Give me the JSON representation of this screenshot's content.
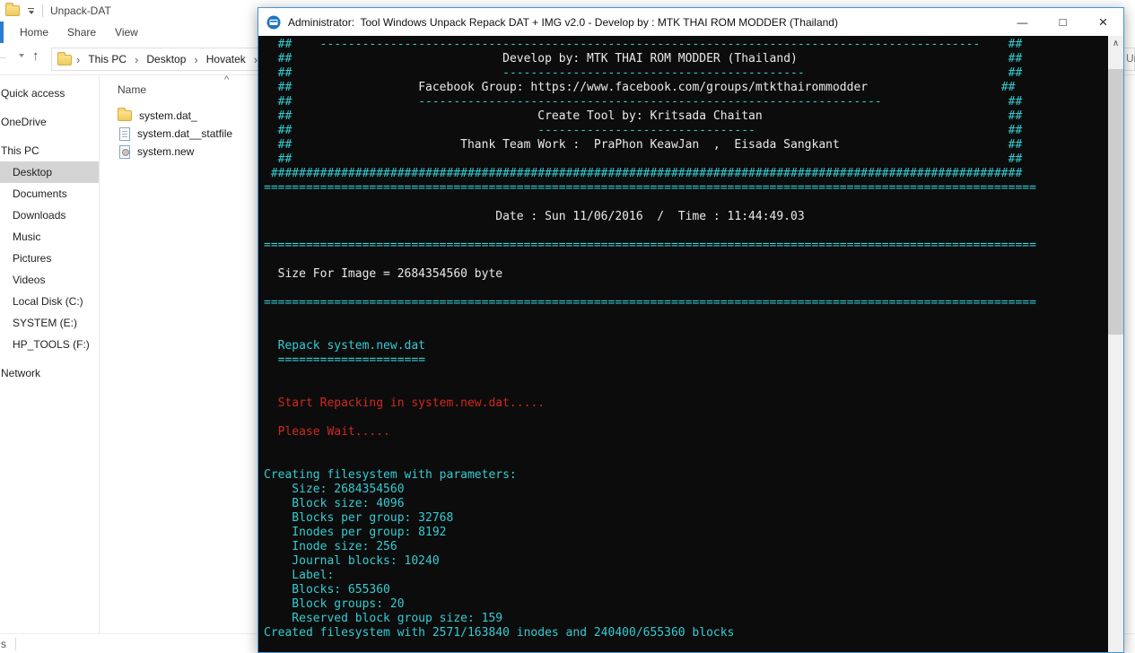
{
  "explorer": {
    "window_title": "Unpack-DAT",
    "ribbon_tabs": [
      "Home",
      "Share",
      "View"
    ],
    "breadcrumb": [
      "This PC",
      "Desktop",
      "Hovatek"
    ],
    "search_fragment": "Un",
    "status_fragment": "s",
    "icons": {
      "chevron": "›",
      "back": "←",
      "up": "↑",
      "sort": "^"
    },
    "sidebar": [
      {
        "label": "Quick access",
        "level": 0
      },
      {
        "label": "OneDrive",
        "level": 0
      },
      {
        "label": "This PC",
        "level": 0
      },
      {
        "label": "Desktop",
        "level": 1,
        "selected": true
      },
      {
        "label": "Documents",
        "level": 1
      },
      {
        "label": "Downloads",
        "level": 1
      },
      {
        "label": "Music",
        "level": 1
      },
      {
        "label": "Pictures",
        "level": 1
      },
      {
        "label": "Videos",
        "level": 1
      },
      {
        "label": "Local Disk (C:)",
        "level": 1
      },
      {
        "label": "SYSTEM (E:)",
        "level": 1
      },
      {
        "label": "HP_TOOLS (F:)",
        "level": 1
      },
      {
        "label": "Network",
        "level": 0
      }
    ],
    "file_list": {
      "column_header": "Name",
      "files": [
        {
          "name": "system.dat_",
          "icon": "folder"
        },
        {
          "name": "system.dat__statfile",
          "icon": "text-file"
        },
        {
          "name": "system.new",
          "icon": "generic-file"
        }
      ]
    }
  },
  "console": {
    "title": "Administrator:  Tool Windows Unpack Repack DAT + IMG v2.0 - Develop by : MTK THAI ROM MODDER (Thailand)",
    "icons": {
      "minimize": "—",
      "maximize": "□",
      "close": "×",
      "scroll_up": "∧"
    },
    "colors": {
      "cyan": "#35ccd2",
      "white": "#e9e9e9",
      "red": "#d0281f",
      "background": "#0c0c0c"
    },
    "lines": [
      [
        [
          "c",
          "  ##    "
        ],
        [
          "c",
          "-",
          94
        ],
        [
          "c",
          " ",
          4
        ],
        [
          "c",
          "##"
        ]
      ],
      [
        [
          "c",
          "  ##"
        ],
        [
          "c",
          " ",
          30
        ],
        [
          "w",
          "Develop by: MTK THAI ROM MODDER (Thailand)"
        ],
        [
          "c",
          " ",
          30
        ],
        [
          "c",
          "##"
        ]
      ],
      [
        [
          "c",
          "  ##"
        ],
        [
          "c",
          " ",
          30
        ],
        [
          "c",
          "-",
          43
        ],
        [
          "c",
          " ",
          29
        ],
        [
          "c",
          "##"
        ]
      ],
      [
        [
          "c",
          "  ##"
        ],
        [
          "c",
          " ",
          18
        ],
        [
          "w",
          "Facebook Group: https://www.facebook.com/groups/mtkthairommodder"
        ],
        [
          "c",
          " ",
          19
        ],
        [
          "c",
          "##"
        ]
      ],
      [
        [
          "c",
          "  ##"
        ],
        [
          "c",
          " ",
          18
        ],
        [
          "c",
          "-",
          66
        ],
        [
          "c",
          " ",
          18
        ],
        [
          "c",
          "##"
        ]
      ],
      [
        [
          "c",
          "  ##"
        ],
        [
          "c",
          " ",
          35
        ],
        [
          "w",
          "Create Tool by: Kritsada Chaitan"
        ],
        [
          "c",
          " ",
          35
        ],
        [
          "c",
          "##"
        ]
      ],
      [
        [
          "c",
          "  ##"
        ],
        [
          "c",
          " ",
          35
        ],
        [
          "c",
          "-",
          31
        ],
        [
          "c",
          " ",
          36
        ],
        [
          "c",
          "##"
        ]
      ],
      [
        [
          "c",
          "  ##"
        ],
        [
          "c",
          " ",
          24
        ],
        [
          "w",
          "Thank Team Work :  PraPhon KeawJan  ,  Eisada Sangkant"
        ],
        [
          "c",
          " ",
          24
        ],
        [
          "c",
          "##"
        ]
      ],
      [
        [
          "c",
          "  ##"
        ],
        [
          "c",
          " ",
          102
        ],
        [
          "c",
          "##"
        ]
      ],
      [
        [
          "c",
          " "
        ],
        [
          "c",
          "#",
          107
        ]
      ],
      [
        [
          "c",
          "=",
          110
        ]
      ],
      [],
      [
        [
          "c",
          " ",
          33
        ],
        [
          "w",
          "Date : Sun 11/06/2016  /  Time : 11:44:49.03"
        ]
      ],
      [],
      [
        [
          "c",
          "=",
          110
        ]
      ],
      [],
      [
        [
          "w",
          "  Size For Image = 2684354560 byte"
        ]
      ],
      [],
      [
        [
          "c",
          "=",
          110
        ]
      ],
      [],
      [],
      [
        [
          "c",
          "  Repack system.new.dat"
        ]
      ],
      [
        [
          "c",
          "  "
        ],
        [
          "c",
          "=",
          21
        ]
      ],
      [],
      [],
      [
        [
          "r",
          "  Start Repacking in system.new.dat....."
        ]
      ],
      [],
      [
        [
          "r",
          "  Please Wait....."
        ]
      ],
      [],
      [],
      [
        [
          "c",
          "Creating filesystem with parameters:"
        ]
      ],
      [
        [
          "c",
          "    Size: 2684354560"
        ]
      ],
      [
        [
          "c",
          "    Block size: 4096"
        ]
      ],
      [
        [
          "c",
          "    Blocks per group: 32768"
        ]
      ],
      [
        [
          "c",
          "    Inodes per group: 8192"
        ]
      ],
      [
        [
          "c",
          "    Inode size: 256"
        ]
      ],
      [
        [
          "c",
          "    Journal blocks: 10240"
        ]
      ],
      [
        [
          "c",
          "    Label: "
        ]
      ],
      [
        [
          "c",
          "    Blocks: 655360"
        ]
      ],
      [
        [
          "c",
          "    Block groups: 20"
        ]
      ],
      [
        [
          "c",
          "    Reserved block group size: 159"
        ]
      ],
      [
        [
          "c",
          "Created filesystem with 2571/163840 inodes and 240400/655360 blocks"
        ]
      ]
    ]
  }
}
